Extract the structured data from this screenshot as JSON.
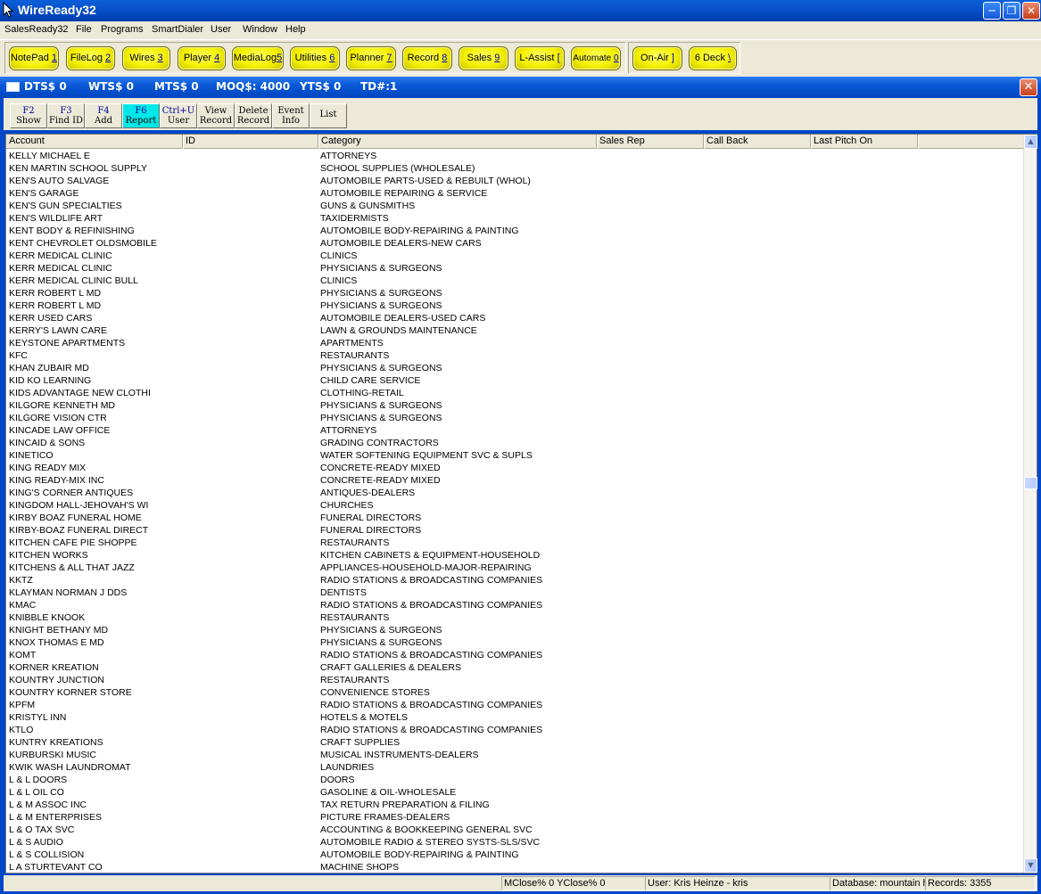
{
  "window": {
    "title": "WireReady32"
  },
  "menu": [
    "SalesReady32",
    "File",
    "Programs",
    "SmartDialer",
    "User",
    "Window",
    "Help"
  ],
  "modules": [
    {
      "label": "NotePad",
      "key": "1"
    },
    {
      "label": "FileLog",
      "key": "2"
    },
    {
      "label": "Wires",
      "key": "3"
    },
    {
      "label": "Player",
      "key": "4"
    },
    {
      "label": "MediaLog",
      "key": "5"
    },
    {
      "label": "Utilities",
      "key": "6"
    },
    {
      "label": "Planner",
      "key": "7"
    },
    {
      "label": "Record",
      "key": "8"
    },
    {
      "label": "Sales",
      "key": "9"
    },
    {
      "label": "L-Assist",
      "key": "["
    },
    {
      "label": "Automate",
      "key": "0"
    },
    {
      "label": "On-Air",
      "key": "]"
    },
    {
      "label": "6 Deck",
      "key": "\\"
    }
  ],
  "stats": {
    "dts": "DTS$ 0",
    "wts": "WTS$ 0",
    "mts": "MTS$ 0",
    "moq": "MOQ$: 4000",
    "yts": "YTS$ 0",
    "td": "TD#:1"
  },
  "toolbar": [
    {
      "key": "F2",
      "label": "Show"
    },
    {
      "key": "F3",
      "label": "Find ID"
    },
    {
      "key": "F4",
      "label": "Add"
    },
    {
      "key": "F6",
      "label": "Report",
      "active": true
    },
    {
      "key": "Ctrl+U",
      "label": "User"
    },
    {
      "key": "View",
      "label": "Record"
    },
    {
      "key": "Delete",
      "label": "Record"
    },
    {
      "key": "Event",
      "label": "Info"
    },
    {
      "key": "",
      "label": "List"
    }
  ],
  "columns": [
    "Account",
    "ID",
    "Category",
    "Sales Rep",
    "Call Back",
    "Last Pitch On"
  ],
  "rows": [
    [
      "KELLY MICHAEL E",
      "ATTORNEYS"
    ],
    [
      "KEN MARTIN SCHOOL SUPPLY",
      "SCHOOL SUPPLIES (WHOLESALE)"
    ],
    [
      "KEN'S AUTO SALVAGE",
      "AUTOMOBILE PARTS-USED & REBUILT (WHOL)"
    ],
    [
      "KEN'S GARAGE",
      "AUTOMOBILE REPAIRING & SERVICE"
    ],
    [
      "KEN'S GUN SPECIALTIES",
      "GUNS & GUNSMITHS"
    ],
    [
      "KEN'S WILDLIFE ART",
      "TAXIDERMISTS"
    ],
    [
      "KENT BODY & REFINISHING",
      "AUTOMOBILE BODY-REPAIRING & PAINTING"
    ],
    [
      "KENT CHEVROLET OLDSMOBILE",
      "AUTOMOBILE DEALERS-NEW CARS"
    ],
    [
      "KERR MEDICAL CLINIC",
      "CLINICS"
    ],
    [
      "KERR MEDICAL CLINIC",
      "PHYSICIANS & SURGEONS"
    ],
    [
      "KERR MEDICAL CLINIC BULL",
      "CLINICS"
    ],
    [
      "KERR ROBERT L MD",
      "PHYSICIANS & SURGEONS"
    ],
    [
      "KERR ROBERT L MD",
      "PHYSICIANS & SURGEONS"
    ],
    [
      "KERR USED CARS",
      "AUTOMOBILE DEALERS-USED CARS"
    ],
    [
      "KERRY'S LAWN CARE",
      "LAWN & GROUNDS MAINTENANCE"
    ],
    [
      "KEYSTONE APARTMENTS",
      "APARTMENTS"
    ],
    [
      "KFC",
      "RESTAURANTS"
    ],
    [
      "KHAN ZUBAIR MD",
      "PHYSICIANS & SURGEONS"
    ],
    [
      "KID KO LEARNING",
      "CHILD CARE SERVICE"
    ],
    [
      "KIDS ADVANTAGE NEW CLOTHI",
      "CLOTHING-RETAIL"
    ],
    [
      "KILGORE KENNETH MD",
      "PHYSICIANS & SURGEONS"
    ],
    [
      "KILGORE VISION CTR",
      "PHYSICIANS & SURGEONS"
    ],
    [
      "KINCADE LAW OFFICE",
      "ATTORNEYS"
    ],
    [
      "KINCAID & SONS",
      "GRADING CONTRACTORS"
    ],
    [
      "KINETICO",
      "WATER SOFTENING EQUIPMENT SVC & SUPLS"
    ],
    [
      "KING READY MIX",
      "CONCRETE-READY MIXED"
    ],
    [
      "KING READY-MIX INC",
      "CONCRETE-READY MIXED"
    ],
    [
      "KING'S CORNER ANTIQUES",
      "ANTIQUES-DEALERS"
    ],
    [
      "KINGDOM HALL-JEHOVAH'S WI",
      "CHURCHES"
    ],
    [
      "KIRBY BOAZ FUNERAL HOME",
      "FUNERAL DIRECTORS"
    ],
    [
      "KIRBY-BOAZ FUNERAL DIRECT",
      "FUNERAL DIRECTORS"
    ],
    [
      "KITCHEN CAFE PIE SHOPPE",
      "RESTAURANTS"
    ],
    [
      "KITCHEN WORKS",
      "KITCHEN CABINETS & EQUIPMENT-HOUSEHOLD"
    ],
    [
      "KITCHENS & ALL THAT JAZZ",
      "APPLIANCES-HOUSEHOLD-MAJOR-REPAIRING"
    ],
    [
      "KKTZ",
      "RADIO STATIONS & BROADCASTING COMPANIES"
    ],
    [
      "KLAYMAN NORMAN J DDS",
      "DENTISTS"
    ],
    [
      "KMAC",
      "RADIO STATIONS & BROADCASTING COMPANIES"
    ],
    [
      "KNIBBLE KNOOK",
      "RESTAURANTS"
    ],
    [
      "KNIGHT BETHANY MD",
      "PHYSICIANS & SURGEONS"
    ],
    [
      "KNOX THOMAS E MD",
      "PHYSICIANS & SURGEONS"
    ],
    [
      "KOMT",
      "RADIO STATIONS & BROADCASTING COMPANIES"
    ],
    [
      "KORNER KREATION",
      "CRAFT GALLERIES & DEALERS"
    ],
    [
      "KOUNTRY JUNCTION",
      "RESTAURANTS"
    ],
    [
      "KOUNTRY KORNER STORE",
      "CONVENIENCE STORES"
    ],
    [
      "KPFM",
      "RADIO STATIONS & BROADCASTING COMPANIES"
    ],
    [
      "KRISTYL INN",
      "HOTELS & MOTELS"
    ],
    [
      "KTLO",
      "RADIO STATIONS & BROADCASTING COMPANIES"
    ],
    [
      "KUNTRY KREATIONS",
      "CRAFT SUPPLIES"
    ],
    [
      "KURBURSKI MUSIC",
      "MUSICAL INSTRUMENTS-DEALERS"
    ],
    [
      "KWIK WASH LAUNDROMAT",
      "LAUNDRIES"
    ],
    [
      "L & L DOORS",
      "DOORS"
    ],
    [
      "L & L OIL CO",
      "GASOLINE & OIL-WHOLESALE"
    ],
    [
      "L & M ASSOC INC",
      "TAX RETURN PREPARATION & FILING"
    ],
    [
      "L & M ENTERPRISES",
      "PICTURE FRAMES-DEALERS"
    ],
    [
      "L & O TAX SVC",
      "ACCOUNTING & BOOKKEEPING GENERAL SVC"
    ],
    [
      "L & S AUDIO",
      "AUTOMOBILE RADIO & STEREO SYSTS-SLS/SVC"
    ],
    [
      "L & S COLLISION",
      "AUTOMOBILE BODY-REPAIRING & PAINTING"
    ],
    [
      "L A STURTEVANT CO",
      "MACHINE SHOPS"
    ]
  ],
  "scroll_position": 0.47,
  "status": {
    "close": "MClose% 0 YClose% 0",
    "user": "User: Kris Heinze - kris",
    "database": "Database: mountain h",
    "records": "Records: 3355"
  }
}
